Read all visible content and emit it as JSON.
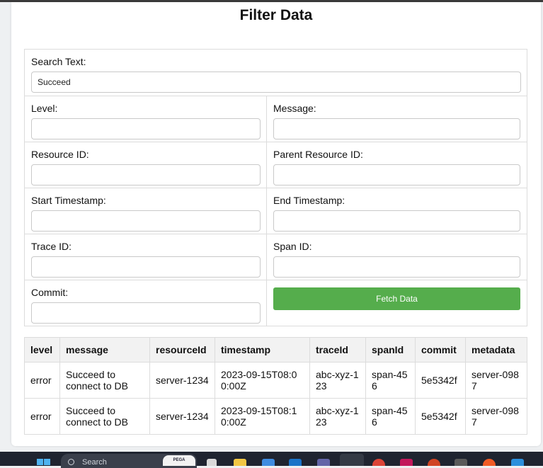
{
  "page": {
    "title": "Filter Data"
  },
  "form": {
    "search_text": {
      "label": "Search Text:",
      "value": "Succeed"
    },
    "level": {
      "label": "Level:",
      "value": ""
    },
    "message": {
      "label": "Message:",
      "value": ""
    },
    "resource_id": {
      "label": "Resource ID:",
      "value": ""
    },
    "parent_resource_id": {
      "label": "Parent Resource ID:",
      "value": ""
    },
    "start_timestamp": {
      "label": "Start Timestamp:",
      "value": ""
    },
    "end_timestamp": {
      "label": "End Timestamp:",
      "value": ""
    },
    "trace_id": {
      "label": "Trace ID:",
      "value": ""
    },
    "span_id": {
      "label": "Span ID:",
      "value": ""
    },
    "commit": {
      "label": "Commit:",
      "value": ""
    },
    "fetch_button": "Fetch Data",
    "fetch_button_color": "#55ad4c"
  },
  "table": {
    "headers": [
      "level",
      "message",
      "resourceId",
      "timestamp",
      "traceId",
      "spanId",
      "commit",
      "metadata"
    ],
    "rows": [
      [
        "error",
        "Succeed to connect to DB",
        "server-1234",
        "2023-09-15T08:00:00Z",
        "abc-xyz-123",
        "span-456",
        "5e5342f",
        "server-0987"
      ],
      [
        "error",
        "Succeed to connect to DB",
        "server-1234",
        "2023-09-15T08:10:00Z",
        "abc-xyz-123",
        "span-456",
        "5e5342f",
        "server-0987"
      ]
    ]
  },
  "taskbar": {
    "search_placeholder": "Search",
    "search_badge": "PEGA",
    "icons": [
      "windows-start-icon",
      "search-icon",
      "file-icon",
      "folder-icon",
      "store-icon",
      "outlook-icon",
      "teams-icon",
      "edge-icon",
      "chrome-icon",
      "intellij-icon",
      "powerpoint-icon",
      "terminal-icon",
      "postman-icon",
      "vscode-icon"
    ]
  }
}
